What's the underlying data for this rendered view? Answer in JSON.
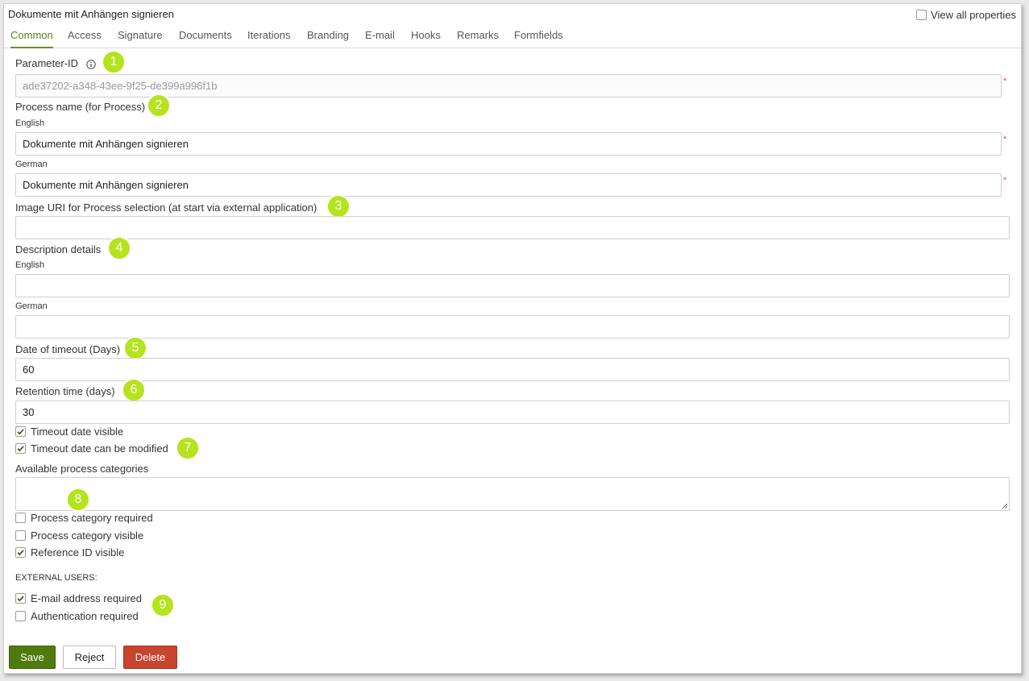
{
  "window": {
    "title": "Dokumente mit Anhängen signieren",
    "view_all_label": "View all properties"
  },
  "tabs": [
    {
      "label": "Common"
    },
    {
      "label": "Access"
    },
    {
      "label": "Signature"
    },
    {
      "label": "Documents"
    },
    {
      "label": "Iterations"
    },
    {
      "label": "Branding"
    },
    {
      "label": "E-mail"
    },
    {
      "label": "Hooks"
    },
    {
      "label": "Remarks"
    },
    {
      "label": "Formfields"
    }
  ],
  "form": {
    "parameter_id_label": "Parameter-ID",
    "parameter_id_value": "ade37202-a348-43ee-9f25-de399a996f1b",
    "process_name_label": "Process name (for Process)",
    "english_label": "English",
    "german_label": "German",
    "process_name_en": "Dokumente mit Anhängen signieren",
    "process_name_de": "Dokumente mit Anhängen signieren",
    "image_uri_label": "Image URI for Process selection (at start via external application)",
    "image_uri_value": "",
    "description_label": "Description details",
    "description_en": "",
    "description_de": "",
    "timeout_label": "Date of timeout (Days)",
    "timeout_value": "60",
    "retention_label": "Retention time (days)",
    "retention_value": "30",
    "timeout_visible_label": "Timeout date visible",
    "timeout_modifiable_label": "Timeout date can be modified",
    "categories_label": "Available process categories",
    "category_required_label": "Process category required",
    "category_visible_label": "Process category visible",
    "reference_visible_label": "Reference ID visible",
    "external_users_label": "EXTERNAL USERS:",
    "email_required_label": "E-mail address required",
    "auth_required_label": "Authentication required",
    "required_marker": "*"
  },
  "checkboxes": {
    "view_all": false,
    "timeout_visible": true,
    "timeout_modifiable": true,
    "category_required": false,
    "category_visible": false,
    "reference_visible": true,
    "email_required": true,
    "auth_required": false
  },
  "badges": [
    "1",
    "2",
    "3",
    "4",
    "5",
    "6",
    "7",
    "8",
    "9"
  ],
  "buttons": {
    "save": "Save",
    "reject": "Reject",
    "delete": "Delete"
  },
  "colors": {
    "accent": "#6f8f22",
    "badge": "#b5e31d",
    "save": "#4f7a0e",
    "delete": "#c8442d",
    "required": "#d9534f"
  }
}
